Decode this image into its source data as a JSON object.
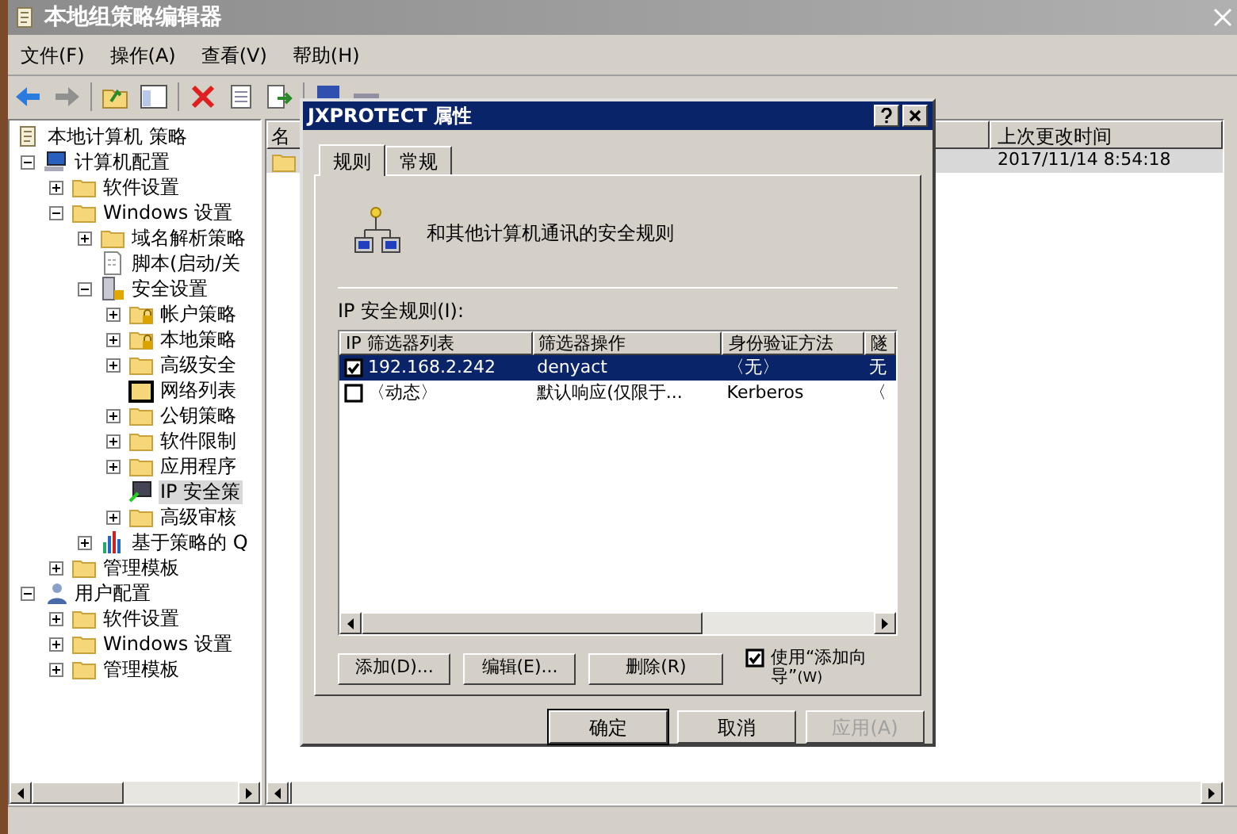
{
  "window": {
    "title": "本地组策略编辑器"
  },
  "menu": [
    "文件(F)",
    "操作(A)",
    "查看(V)",
    "帮助(H)"
  ],
  "tree": [
    {
      "label": "本地计算机 策略",
      "kind": "scroll",
      "selected": false,
      "children": [
        {
          "label": "计算机配置",
          "kind": "computer",
          "expanded": true,
          "selected": false,
          "children": [
            {
              "label": "软件设置",
              "kind": "folder",
              "expanded": false,
              "selected": false
            },
            {
              "label": "Windows 设置",
              "kind": "folder",
              "expanded": true,
              "selected": false,
              "children": [
                {
                  "label": "域名解析策略",
                  "kind": "folder",
                  "expanded": false,
                  "selected": false
                },
                {
                  "label": "脚本(启动/关",
                  "kind": "script",
                  "selected": false
                },
                {
                  "label": "安全设置",
                  "kind": "security",
                  "expanded": true,
                  "selected": false,
                  "children": [
                    {
                      "label": "帐户策略",
                      "kind": "folder-lock",
                      "expanded": false,
                      "selected": false
                    },
                    {
                      "label": "本地策略",
                      "kind": "folder-lock",
                      "expanded": false,
                      "selected": false
                    },
                    {
                      "label": "高级安全",
                      "kind": "folder",
                      "expanded": false,
                      "selected": false
                    },
                    {
                      "label": "网络列表",
                      "kind": "network-list",
                      "selected": false
                    },
                    {
                      "label": "公钥策略",
                      "kind": "folder",
                      "expanded": false,
                      "selected": false
                    },
                    {
                      "label": "软件限制",
                      "kind": "folder",
                      "expanded": false,
                      "selected": false
                    },
                    {
                      "label": "应用程序",
                      "kind": "folder",
                      "expanded": false,
                      "selected": false
                    },
                    {
                      "label": "IP 安全策",
                      "kind": "ip-security",
                      "selected": true
                    },
                    {
                      "label": "高级审核",
                      "kind": "folder",
                      "expanded": false,
                      "selected": false
                    }
                  ]
                },
                {
                  "label": "基于策略的 Q",
                  "kind": "chart",
                  "expanded": false,
                  "selected": false
                }
              ]
            },
            {
              "label": "管理模板",
              "kind": "folder",
              "expanded": false,
              "selected": false
            }
          ]
        },
        {
          "label": "用户配置",
          "kind": "user",
          "expanded": true,
          "selected": false,
          "children": [
            {
              "label": "软件设置",
              "kind": "folder",
              "expanded": false,
              "selected": false
            },
            {
              "label": "Windows 设置",
              "kind": "folder",
              "expanded": false,
              "selected": false
            },
            {
              "label": "管理模板",
              "kind": "folder",
              "expanded": false,
              "selected": false
            }
          ]
        }
      ]
    }
  ],
  "list": {
    "columns": [
      "名",
      "上次更改时间"
    ],
    "rows": [
      {
        "column_2": "2017/11/14 8:54:18",
        "selected": true
      }
    ]
  },
  "dialog": {
    "title": "JXPROTECT 属性",
    "tabs": [
      {
        "label": "规则",
        "selected": true
      },
      {
        "label": "常规",
        "selected": false
      }
    ],
    "heading": "和其他计算机通讯的安全规则",
    "rules_label": "IP 安全规则(I):",
    "columns": [
      "IP 筛选器列表",
      "筛选器操作",
      "身份验证方法",
      "隧"
    ],
    "rules": [
      {
        "checked": true,
        "selected": true,
        "cells": [
          "192.168.2.242",
          "denyact",
          "〈无〉",
          "无"
        ]
      },
      {
        "checked": false,
        "selected": false,
        "cells": [
          "〈动态〉",
          "默认响应(仅限于...",
          "Kerberos",
          "〈"
        ]
      }
    ],
    "rule_buttons": [
      "添加(D)...",
      "编辑(E)...",
      "删除(R)"
    ],
    "wizard": {
      "label": "使用“添加向导”",
      "shortcut": "(W)",
      "checked": true
    },
    "buttons": [
      {
        "label": "确定",
        "default": true,
        "disabled": false
      },
      {
        "label": "取消",
        "default": false,
        "disabled": false
      },
      {
        "label": "应用(A)",
        "default": false,
        "disabled": true
      }
    ]
  }
}
